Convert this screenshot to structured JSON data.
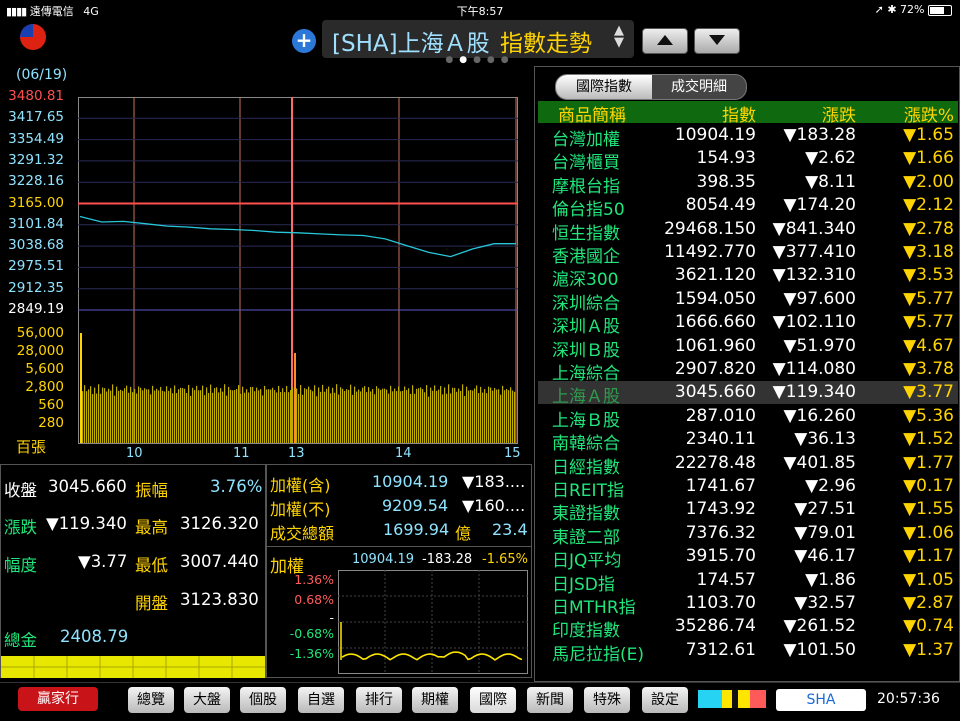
{
  "status": {
    "carrier": "遠傳電信",
    "network": "4G",
    "time": "下午8:57",
    "battery": "72%"
  },
  "header": {
    "code": "[SHA]上海Ａ股",
    "title": "指數走勢"
  },
  "chart": {
    "date": "(06/19)",
    "y_labels": [
      {
        "text": "3480.81",
        "color": "#ff5050"
      },
      {
        "text": "3417.65",
        "color": "#8fe3ff"
      },
      {
        "text": "3354.49",
        "color": "#8fe3ff"
      },
      {
        "text": "3291.32",
        "color": "#8fe3ff"
      },
      {
        "text": "3228.16",
        "color": "#8fe3ff"
      },
      {
        "text": "3165.00",
        "color": "#ffd400"
      },
      {
        "text": "3101.84",
        "color": "#8fe3ff"
      },
      {
        "text": "3038.68",
        "color": "#8fe3ff"
      },
      {
        "text": "2975.51",
        "color": "#8fe3ff"
      },
      {
        "text": "2912.35",
        "color": "#8fe3ff"
      },
      {
        "text": "2849.19",
        "color": "#ffffff"
      }
    ],
    "vol_labels": [
      "56,000",
      "28,000",
      "5,600",
      "2,800",
      "560",
      "280"
    ],
    "vol_unit": "百張",
    "x_labels": [
      "10",
      "11",
      "13",
      "14",
      "15"
    ]
  },
  "chart_data": {
    "type": "line",
    "xlabel": "",
    "ylabel": "",
    "x_ticks": [
      "10",
      "11",
      "13",
      "14",
      "15"
    ],
    "ylim": [
      2849.19,
      3480.81
    ],
    "reference_close": 3165.0,
    "series": [
      {
        "values": [
          3126.32,
          3110,
          3112,
          3105,
          3098,
          3095,
          3090,
          3088,
          3085,
          3080,
          3078,
          3075,
          3072,
          3070,
          3060,
          3040,
          3020,
          3007.44,
          3030,
          3045.66,
          3045.66
        ]
      }
    ]
  },
  "quote": {
    "close_label": "收盤",
    "close": "3045.660",
    "amp_label": "振幅",
    "amp": "3.76%",
    "chg_label": "漲跌",
    "chg": "▼119.340",
    "high_label": "最高",
    "high": "3126.320",
    "pct_label": "幅度",
    "pct": "▼3.77",
    "low_label": "最低",
    "low": "3007.440",
    "open_label": "開盤",
    "open": "3123.830",
    "total_label": "總金",
    "total": "2408.79"
  },
  "taiex": {
    "r1_label": "加權(含)",
    "r1_val": "10904.19",
    "r1_chg": "▼183....",
    "r2_label": "加權(不)",
    "r2_val": "9209.54",
    "r2_chg": "▼160....",
    "r3_label": "成交總額",
    "r3_val": "1699.94",
    "r3_unit": "億",
    "r3_extra": "23.4",
    "mini_label": "加權",
    "mini_price": "10904.19",
    "mini_chg": "-183.28",
    "mini_pct": "-1.65%",
    "mini_y": [
      "1.36%",
      "0.68%",
      "-",
      "-0.68%",
      "-1.36%"
    ]
  },
  "right": {
    "tab_active": "國際指數",
    "tab_other": "成交明細",
    "headers": {
      "name": "商品簡稱",
      "price": "指數",
      "chg": "漲跌",
      "pct": "漲跌%"
    },
    "rows": [
      {
        "name": "台灣加權",
        "price": "10904.19",
        "chg": "▼183.28",
        "pct": "▼1.65"
      },
      {
        "name": "台灣櫃買",
        "price": "154.93",
        "chg": "▼2.62",
        "pct": "▼1.66"
      },
      {
        "name": "摩根台指",
        "price": "398.35",
        "chg": "▼8.11",
        "pct": "▼2.00"
      },
      {
        "name": "倫台指50",
        "price": "8054.49",
        "chg": "▼174.20",
        "pct": "▼2.12"
      },
      {
        "name": "恒生指數",
        "price": "29468.150",
        "chg": "▼841.340",
        "pct": "▼2.78"
      },
      {
        "name": "香港國企",
        "price": "11492.770",
        "chg": "▼377.410",
        "pct": "▼3.18"
      },
      {
        "name": "滬深300",
        "price": "3621.120",
        "chg": "▼132.310",
        "pct": "▼3.53"
      },
      {
        "name": "深圳綜合",
        "price": "1594.050",
        "chg": "▼97.600",
        "pct": "▼5.77"
      },
      {
        "name": "深圳Ａ股",
        "price": "1666.660",
        "chg": "▼102.110",
        "pct": "▼5.77"
      },
      {
        "name": "深圳Ｂ股",
        "price": "1061.960",
        "chg": "▼51.970",
        "pct": "▼4.67"
      },
      {
        "name": "上海綜合",
        "price": "2907.820",
        "chg": "▼114.080",
        "pct": "▼3.78"
      },
      {
        "name": "上海Ａ股",
        "price": "3045.660",
        "chg": "▼119.340",
        "pct": "▼3.77"
      },
      {
        "name": "上海Ｂ股",
        "price": "287.010",
        "chg": "▼16.260",
        "pct": "▼5.36"
      },
      {
        "name": "南韓綜合",
        "price": "2340.11",
        "chg": "▼36.13",
        "pct": "▼1.52"
      },
      {
        "name": "日經指數",
        "price": "22278.48",
        "chg": "▼401.85",
        "pct": "▼1.77"
      },
      {
        "name": "日REIT指",
        "price": "1741.67",
        "chg": "▼2.96",
        "pct": "▼0.17"
      },
      {
        "name": "東證指數",
        "price": "1743.92",
        "chg": "▼27.51",
        "pct": "▼1.55"
      },
      {
        "name": "東證二部",
        "price": "7376.32",
        "chg": "▼79.01",
        "pct": "▼1.06"
      },
      {
        "name": "日JQ平均",
        "price": "3915.70",
        "chg": "▼46.17",
        "pct": "▼1.17"
      },
      {
        "name": "日JSD指",
        "price": "174.57",
        "chg": "▼1.86",
        "pct": "▼1.05"
      },
      {
        "name": "日MTHR指",
        "price": "1103.70",
        "chg": "▼32.57",
        "pct": "▼2.87"
      },
      {
        "name": "印度指數",
        "price": "35286.74",
        "chg": "▼261.52",
        "pct": "▼0.74"
      },
      {
        "name": "馬尼拉指(E)",
        "price": "7312.61",
        "chg": "▼101.50",
        "pct": "▼1.37"
      }
    ]
  },
  "toolbar": {
    "brand": "贏家行",
    "items": [
      "總覽",
      "大盤",
      "個股",
      "自選",
      "排行",
      "期權",
      "國際",
      "新聞",
      "特殊",
      "設定"
    ],
    "symbol": "SHA",
    "clock": "20:57:36"
  }
}
